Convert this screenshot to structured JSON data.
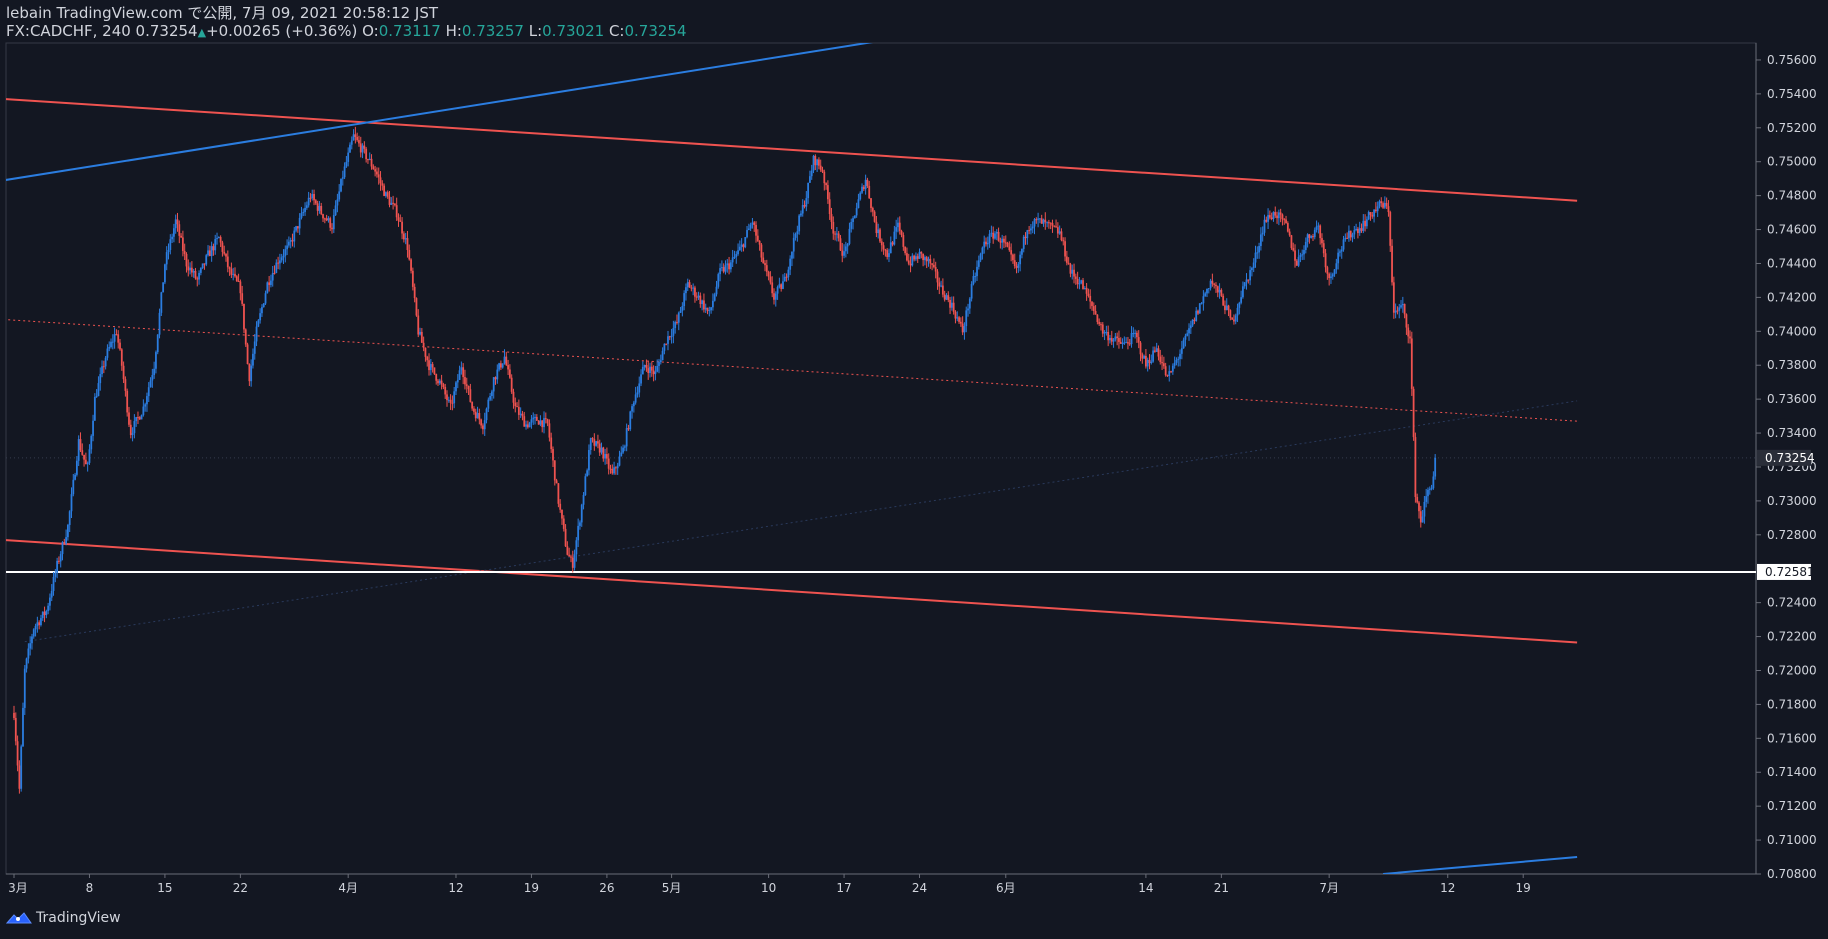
{
  "header": {
    "publish_line": "lebain TradingView.com で公開, 7月 09, 2021 20:58:12 JST",
    "symbol_line": "FX:CADCHF, 240 0.73254",
    "change": "+0.00265 (+0.36%)",
    "o_label": "O:",
    "o_value": "0.73117",
    "h_label": "H:",
    "h_value": "0.73257",
    "l_label": "L:",
    "l_value": "0.73021",
    "c_label": "C:",
    "c_value": "0.73254"
  },
  "footer": {
    "brand": "TradingView",
    "logo_icon": "tradingview-logo-icon"
  },
  "colors": {
    "background": "#131722",
    "up": "#2b7de0",
    "down": "#ef5350",
    "trendline_red": "#ef5350",
    "trendline_blue": "#2b7de0",
    "support_line": "#ffffff",
    "text": "#d1d4dc",
    "header_value": "#26a69a"
  },
  "chart_data": {
    "type": "candlestick",
    "symbol": "FX:CADCHF",
    "interval": "240",
    "ylim": [
      0.708,
      0.757
    ],
    "y_ticks": [
      "0.75600",
      "0.75400",
      "0.75200",
      "0.75000",
      "0.74800",
      "0.74600",
      "0.74400",
      "0.74200",
      "0.74000",
      "0.73800",
      "0.73600",
      "0.73400",
      "0.73200",
      "0.73000",
      "0.72800",
      "0.72400",
      "0.72200",
      "0.72000",
      "0.71800",
      "0.71600",
      "0.71400",
      "0.71200",
      "0.71000",
      "0.70800"
    ],
    "x_ticks": [
      {
        "label": "3月",
        "day": 0
      },
      {
        "label": "8",
        "day": 7
      },
      {
        "label": "15",
        "day": 14
      },
      {
        "label": "22",
        "day": 21
      },
      {
        "label": "4月",
        "day": 31
      },
      {
        "label": "12",
        "day": 41
      },
      {
        "label": "19",
        "day": 48
      },
      {
        "label": "26",
        "day": 55
      },
      {
        "label": "5月",
        "day": 61
      },
      {
        "label": "10",
        "day": 70
      },
      {
        "label": "17",
        "day": 77
      },
      {
        "label": "24",
        "day": 84
      },
      {
        "label": "6月",
        "day": 92
      },
      {
        "label": "14",
        "day": 105
      },
      {
        "label": "21",
        "day": 112
      },
      {
        "label": "7月",
        "day": 122
      },
      {
        "label": "12",
        "day": 133
      },
      {
        "label": "19",
        "day": 140
      }
    ],
    "price_path": [
      [
        0,
        0.7175
      ],
      [
        0.5,
        0.713
      ],
      [
        1,
        0.72
      ],
      [
        1.8,
        0.7225
      ],
      [
        3,
        0.7235
      ],
      [
        4,
        0.7262
      ],
      [
        5,
        0.7285
      ],
      [
        6,
        0.7335
      ],
      [
        6.8,
        0.7318
      ],
      [
        7.5,
        0.736
      ],
      [
        8.5,
        0.7385
      ],
      [
        9.5,
        0.74
      ],
      [
        10,
        0.738
      ],
      [
        10.8,
        0.734
      ],
      [
        12,
        0.7355
      ],
      [
        13,
        0.738
      ],
      [
        14,
        0.744
      ],
      [
        15,
        0.7465
      ],
      [
        16,
        0.744
      ],
      [
        17,
        0.743
      ],
      [
        18,
        0.7445
      ],
      [
        19,
        0.7455
      ],
      [
        20,
        0.7435
      ],
      [
        21,
        0.7425
      ],
      [
        21.8,
        0.7372
      ],
      [
        22.5,
        0.74
      ],
      [
        23.5,
        0.7428
      ],
      [
        24.5,
        0.7442
      ],
      [
        25.5,
        0.745
      ],
      [
        26.5,
        0.7465
      ],
      [
        27.5,
        0.748
      ],
      [
        28.5,
        0.747
      ],
      [
        29.5,
        0.7462
      ],
      [
        30.5,
        0.7492
      ],
      [
        31.5,
        0.7515
      ],
      [
        32.5,
        0.7505
      ],
      [
        33.5,
        0.7495
      ],
      [
        34.5,
        0.748
      ],
      [
        35.5,
        0.747
      ],
      [
        36.5,
        0.745
      ],
      [
        37.5,
        0.74
      ],
      [
        38.5,
        0.738
      ],
      [
        39.5,
        0.737
      ],
      [
        40.5,
        0.7355
      ],
      [
        41.5,
        0.738
      ],
      [
        42.5,
        0.7355
      ],
      [
        43.5,
        0.7345
      ],
      [
        44.5,
        0.7372
      ],
      [
        45.5,
        0.7385
      ],
      [
        46.5,
        0.7355
      ],
      [
        47.5,
        0.7345
      ],
      [
        48.5,
        0.7348
      ],
      [
        49.5,
        0.7345
      ],
      [
        50.5,
        0.73
      ],
      [
        51.3,
        0.727
      ],
      [
        51.8,
        0.7262
      ],
      [
        52.5,
        0.729
      ],
      [
        53.5,
        0.7335
      ],
      [
        54.5,
        0.733
      ],
      [
        55.5,
        0.7315
      ],
      [
        56.5,
        0.733
      ],
      [
        57.5,
        0.736
      ],
      [
        58.5,
        0.738
      ],
      [
        59.5,
        0.7375
      ],
      [
        60.5,
        0.7395
      ],
      [
        61.5,
        0.7405
      ],
      [
        62.5,
        0.7428
      ],
      [
        63.5,
        0.742
      ],
      [
        64.5,
        0.741
      ],
      [
        65.5,
        0.7435
      ],
      [
        66.5,
        0.744
      ],
      [
        67.5,
        0.745
      ],
      [
        68.5,
        0.7465
      ],
      [
        69.5,
        0.744
      ],
      [
        70.5,
        0.742
      ],
      [
        71.5,
        0.743
      ],
      [
        72.5,
        0.7458
      ],
      [
        73.5,
        0.748
      ],
      [
        74.2,
        0.7502
      ],
      [
        75,
        0.7495
      ],
      [
        76,
        0.746
      ],
      [
        77,
        0.7445
      ],
      [
        78,
        0.747
      ],
      [
        79,
        0.749
      ],
      [
        80,
        0.746
      ],
      [
        81,
        0.7445
      ],
      [
        82,
        0.7462
      ],
      [
        83,
        0.744
      ],
      [
        84,
        0.7445
      ],
      [
        85,
        0.744
      ],
      [
        86,
        0.7425
      ],
      [
        87,
        0.7415
      ],
      [
        88,
        0.74
      ],
      [
        89,
        0.743
      ],
      [
        90,
        0.7452
      ],
      [
        91,
        0.7458
      ],
      [
        92,
        0.745
      ],
      [
        93,
        0.7435
      ],
      [
        94,
        0.7462
      ],
      [
        95,
        0.7465
      ],
      [
        96,
        0.7462
      ],
      [
        97,
        0.7458
      ],
      [
        98,
        0.7435
      ],
      [
        99,
        0.7428
      ],
      [
        100,
        0.7415
      ],
      [
        101,
        0.74
      ],
      [
        102,
        0.7395
      ],
      [
        103,
        0.7392
      ],
      [
        104,
        0.7398
      ],
      [
        105,
        0.738
      ],
      [
        106,
        0.739
      ],
      [
        107,
        0.7372
      ],
      [
        108,
        0.7385
      ],
      [
        109,
        0.74
      ],
      [
        110,
        0.7415
      ],
      [
        111,
        0.743
      ],
      [
        112,
        0.742
      ],
      [
        113,
        0.7405
      ],
      [
        114,
        0.7425
      ],
      [
        115,
        0.744
      ],
      [
        116,
        0.7465
      ],
      [
        117,
        0.747
      ],
      [
        118,
        0.7462
      ],
      [
        119,
        0.744
      ],
      [
        120,
        0.7455
      ],
      [
        121,
        0.7462
      ],
      [
        122,
        0.743
      ],
      [
        123,
        0.7448
      ],
      [
        124,
        0.7458
      ],
      [
        125,
        0.7462
      ],
      [
        126,
        0.747
      ],
      [
        126.8,
        0.7475
      ],
      [
        127.5,
        0.7472
      ],
      [
        128,
        0.741
      ],
      [
        128.8,
        0.7415
      ],
      [
        129.5,
        0.7395
      ],
      [
        130,
        0.7305
      ],
      [
        130.5,
        0.7288
      ],
      [
        131,
        0.7302
      ],
      [
        131.5,
        0.731
      ],
      [
        132,
        0.7325
      ]
    ],
    "trendlines": [
      {
        "name": "upper-channel",
        "color": "#ef5350",
        "x1": -1,
        "y1": 0.7537,
        "x2": 145,
        "y2": 0.7477
      },
      {
        "name": "lower-channel",
        "color": "#ef5350",
        "x1": -1,
        "y1": 0.7277,
        "x2": 145,
        "y2": 0.72165
      },
      {
        "name": "mid-channel-dotted",
        "color": "#ef5350",
        "style": "dotted",
        "x1": -1,
        "y1": 0.7407,
        "x2": 145,
        "y2": 0.7347
      },
      {
        "name": "upper-blue",
        "color": "#2b7de0",
        "x1": -1,
        "y1": 0.7489,
        "x2": 88,
        "y2": 0.7579
      },
      {
        "name": "lower-blue",
        "color": "#2b7de0",
        "x1": 127,
        "y1": 0.708,
        "x2": 145,
        "y2": 0.709
      },
      {
        "name": "faint-diagonal",
        "color": "#2a3a5c",
        "style": "dotted",
        "x1": 1,
        "y1": 0.7217,
        "x2": 145,
        "y2": 0.7359
      }
    ],
    "horizontal_lines": [
      {
        "name": "support",
        "price": 0.72581,
        "label": "0.72581",
        "color": "#ffffff"
      },
      {
        "name": "last-price",
        "price": 0.73254,
        "label": "0.73254",
        "color": "#363c4e"
      }
    ]
  }
}
